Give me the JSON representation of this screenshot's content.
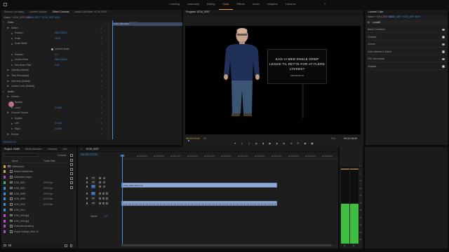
{
  "workspaces": [
    "Learning",
    "Assembly",
    "Editing",
    "Color",
    "Effects",
    "Audio",
    "Graphics",
    "Libraries"
  ],
  "active_workspace": "Color",
  "source_tabs": {
    "items": [
      "Source: (no clips)",
      "Lumetri Scopes",
      "Effect Controls",
      "Audio Clip Mixer: KCM_0097"
    ],
    "active": "Effect Controls"
  },
  "effect_controls": {
    "master": "Master * KCM_0097.MOV",
    "sequence": "KCM_0097 * KCM_0097.MOV",
    "time_header": "00:00:00",
    "clip_label": "KCM_0097.MOV",
    "rows": [
      {
        "label": "Video",
        "value": "",
        "indent": 0,
        "fx": false
      },
      {
        "label": "Motion",
        "value": "",
        "indent": 1,
        "fx": true
      },
      {
        "label": "Position",
        "value": "960.0   540.0",
        "indent": 2,
        "fx": false
      },
      {
        "label": "Scale",
        "value": "100.0",
        "indent": 2,
        "fx": false
      },
      {
        "label": "Scale Width",
        "value": "",
        "indent": 2,
        "fx": false
      },
      {
        "label": "",
        "value": "Uniform Scale",
        "indent": 2,
        "fx": false
      },
      {
        "label": "Rotation",
        "value": "0.0",
        "indent": 2,
        "fx": false
      },
      {
        "label": "Anchor Point",
        "value": "960.0   540.0",
        "indent": 2,
        "fx": false
      },
      {
        "label": "Anti-flicker Filter",
        "value": "0.00",
        "indent": 2,
        "fx": false
      },
      {
        "label": "Opacity (Default)",
        "value": "",
        "indent": 1,
        "fx": true
      },
      {
        "label": "Time Remapping",
        "value": "",
        "indent": 1,
        "fx": true
      },
      {
        "label": "Ultra Key (Default)",
        "value": "",
        "indent": 1,
        "fx": true
      },
      {
        "label": "Lumetri Color (Default)",
        "value": "",
        "indent": 1,
        "fx": true
      },
      {
        "label": "Audio",
        "value": "",
        "indent": 0,
        "fx": false
      },
      {
        "label": "Volume",
        "value": "",
        "indent": 1,
        "fx": true
      },
      {
        "label": "Bypass",
        "value": "",
        "indent": 2,
        "fx": false
      },
      {
        "label": "Level",
        "value": "0.0 dB",
        "indent": 2,
        "fx": false
      },
      {
        "label": "Channel Volume",
        "value": "",
        "indent": 1,
        "fx": true
      },
      {
        "label": "Bypass",
        "value": "",
        "indent": 2,
        "fx": false
      },
      {
        "label": "Left",
        "value": "0.0 dB",
        "indent": 2,
        "fx": false
      },
      {
        "label": "Right",
        "value": "0.0 dB",
        "indent": 2,
        "fx": false
      },
      {
        "label": "Panner",
        "value": "",
        "indent": 1,
        "fx": true
      }
    ],
    "footer_time": "00:00:10:01"
  },
  "program": {
    "tab": "Program: KCM_0097",
    "timecode": "00:00:10:01",
    "fit": "Fit",
    "quality": "Full",
    "duration": "00:12:18:09",
    "slide": {
      "line1": "KAN VI MED ENKLE GREP",
      "line2": "LEGGE TIL RETTE FOR AT FLERE",
      "line3": "LYKKES?",
      "caption": "KROKENE 10"
    },
    "transport": [
      "marker",
      "in",
      "out",
      "go-to-in",
      "step-back",
      "play",
      "step-forward",
      "go-to-out",
      "insert",
      "overwrite",
      "export-frame",
      "compare"
    ]
  },
  "project": {
    "tabs": [
      "Project: Kildfil",
      "Media Browser",
      "Libraries",
      "Info"
    ],
    "active": "Project: Kildfil",
    "search": "",
    "count": "14 items",
    "col_name": "Name",
    "col_fps": "Frame Rate",
    "items": [
      {
        "name": "Kildfil.prproj",
        "fps": "",
        "color": "#c9a24d",
        "indent": 0
      },
      {
        "name": "Nested Sequences",
        "fps": "",
        "color": "#c9a24d",
        "indent": 1
      },
      {
        "name": "Adjustment Layer",
        "fps": "",
        "color": "#b44ec9",
        "indent": 1
      },
      {
        "name": "KCM_0097",
        "fps": "59.94 fps",
        "color": "#3ab56b",
        "indent": 1
      },
      {
        "name": "KCM_0097",
        "fps": "59.94 fps",
        "color": "#3a8fd4",
        "indent": 1
      },
      {
        "name": "KCM_0098",
        "fps": "59.94 fps",
        "color": "#3a8fd4",
        "indent": 1
      },
      {
        "name": "KCM_0099",
        "fps": "59.94 fps",
        "color": "#3a8fd4",
        "indent": 1
      },
      {
        "name": "KCM_0100",
        "fps": "59.94 fps",
        "color": "#3a8fd4",
        "indent": 1
      },
      {
        "name": "KCM_0101",
        "fps": "",
        "color": "#3a8fd4",
        "indent": 1
      },
      {
        "name": "KCM_0102.jpg",
        "fps": "",
        "color": "#b44ec9",
        "indent": 1
      },
      {
        "name": "KCM_0103.jpg",
        "fps": "",
        "color": "#b44ec9",
        "indent": 1
      },
      {
        "name": "Enkleprbr-kantdring",
        "fps": "",
        "color": "#b44ec9",
        "indent": 1
      },
      {
        "name": "Export Settings_Wide 12",
        "fps": "",
        "color": "#b44ec9",
        "indent": 1
      }
    ]
  },
  "timeline": {
    "tab": "KCM_0097",
    "timecode": "00:00:10:01",
    "ruler": [
      "00:00",
      "00:00:04:59",
      "00:00:09:58",
      "00:00:14:57",
      "00:00:19:56",
      "00:00:24:55",
      "00:00:29:54",
      "00:00:34:53",
      "00:00:39:52",
      "00:00:44:51",
      "00:00:49:50",
      "00:00:54:49",
      "00:00:59:48",
      "00:01:04:47"
    ],
    "tracks": [
      "V3",
      "V2",
      "V1",
      "A1",
      "A2",
      "A3"
    ],
    "master_label": "Master",
    "master_value": "0.0",
    "video_clip": "KCM_0097.MOV [V]",
    "audio_clip": "KCM_0097.MOV [A]"
  },
  "lumetri": {
    "tab": "Lumetri Color",
    "master": "Master * KCM_0097.MOV",
    "sequence": "KCM_0097 * KCM_0097.MOV",
    "fx_label": "fx",
    "section_title": "Lumetri",
    "sections": [
      "Basic Correction",
      "Creative",
      "Curves",
      "Color Wheels & Match",
      "HSL Secondary",
      "Vignette"
    ]
  },
  "audio_meter": {
    "labels": [
      "0",
      "-6",
      "-12",
      "-18",
      "-24",
      "-30",
      "-36",
      "-42",
      "-48",
      "-54",
      "dB"
    ],
    "level_fraction": 0.52,
    "solo": "S"
  },
  "colors": {
    "accent": "#3d8bd9",
    "clip_video": "#8fa9d4",
    "clip_audio": "#8da3cc",
    "playhead": "#4a90e2",
    "meter_green": "#3fbf3f",
    "active_workspace": "#e8a33a"
  }
}
